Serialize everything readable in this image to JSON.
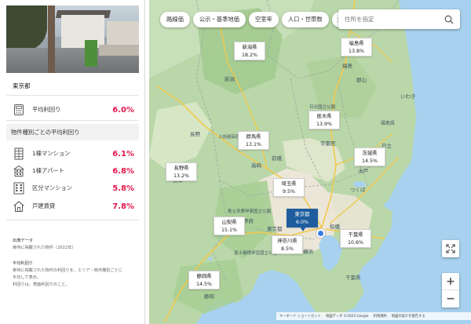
{
  "panel": {
    "pref_name": "東京都",
    "avg_yield": {
      "label": "平均利回り",
      "value": "6.0%",
      "icon": "calculator-icon"
    },
    "section_title": "物件種別ごとの平均利回り",
    "types": [
      {
        "label": "1棟マンション",
        "value": "6.1%",
        "icon": "building-icon"
      },
      {
        "label": "1棟アパート",
        "value": "6.8%",
        "icon": "apartment-icon"
      },
      {
        "label": "区分マンション",
        "value": "5.8%",
        "icon": "unit-mansion-icon"
      },
      {
        "label": "戸建賃貸",
        "value": "7.8%",
        "icon": "house-icon"
      }
    ],
    "footer": {
      "source_title": "出典データ",
      "source_text": "楽待に掲載された物件（2022年）",
      "def_title": "平均利回り",
      "def_line1": "楽待に掲載された物件の利回りを、エリア・物件種別ごとに",
      "def_line2": "平均して表示。",
      "def_line3": "利回りは、表面利回りのこと。"
    }
  },
  "toolbar": {
    "chips": [
      "路線価",
      "公示・基準地価",
      "空室率",
      "人口・世帯数"
    ],
    "more": ">",
    "search_placeholder": "住所を指定"
  },
  "markers": [
    {
      "name": "新潟県",
      "value": "18.2%"
    },
    {
      "name": "福島県",
      "value": "13.8%"
    },
    {
      "name": "栃木県",
      "value": "13.9%"
    },
    {
      "name": "群馬県",
      "value": "13.1%"
    },
    {
      "name": "茨城県",
      "value": "14.5%"
    },
    {
      "name": "長野県",
      "value": "13.2%"
    },
    {
      "name": "埼玉県",
      "value": "9.5%"
    },
    {
      "name": "東京都",
      "value": "6.0%"
    },
    {
      "name": "山梨県",
      "value": "15.1%"
    },
    {
      "name": "神奈川県",
      "value": "8.5%"
    },
    {
      "name": "千葉県",
      "value": "10.6%"
    },
    {
      "name": "静岡県",
      "value": "14.5%"
    }
  ],
  "map_labels": {
    "fukushima": "福島",
    "fukushimaken": "福島県",
    "niigata": "新潟",
    "iwaki": "いわき",
    "nagano": "長野",
    "gunma": "群馬県",
    "tochigi": "栃木県",
    "utsunomiya": "宇都宮",
    "ibaraki": "茨城県",
    "takasaki": "高崎",
    "saitama": "埼玉県",
    "kofu": "甲府",
    "yamanashi": "山梨県",
    "tokyo": "東京都",
    "yokohama": "横浜",
    "chiba": "千葉県",
    "shizuoka": "静岡",
    "funabashi": "船橋",
    "nikko": "日光国立公園",
    "joshinetsu": "上信越高原国立公園",
    "chichibu": "秩父多摩甲斐国立公園",
    "fuji": "富士箱根伊豆国立公園",
    "mito": "水戸",
    "hitachi": "日立",
    "tsukuba": "つくば",
    "koriyama": "郡山",
    "maebashi": "前橋",
    "matsumoto": "松本"
  },
  "attribution": {
    "shortcuts": "キーボード ショートカット",
    "data": "地図データ ©2023 Google",
    "terms": "利用規約",
    "report": "地図の誤りを報告する"
  },
  "controls": {
    "zoom_in": "+",
    "zoom_out": "−"
  }
}
